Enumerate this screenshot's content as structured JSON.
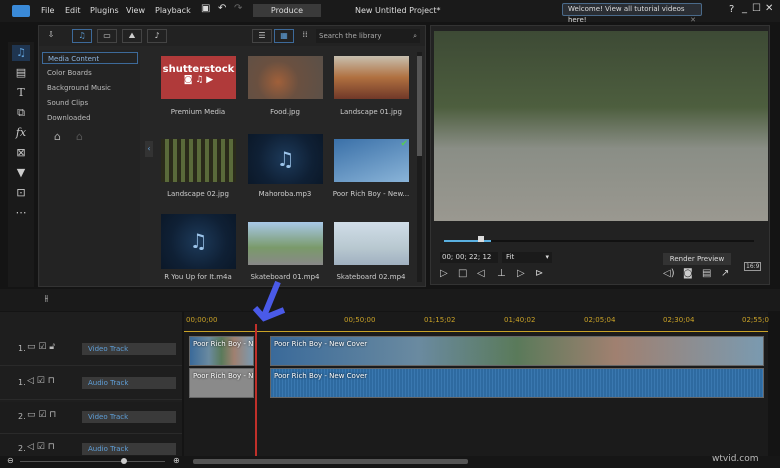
{
  "menu": {
    "items": [
      "File",
      "Edit",
      "Plugins",
      "View",
      "Playback"
    ],
    "produce": "Produce",
    "project_title": "New Untitled Project*",
    "welcome": "Welcome! View all tutorial videos here!",
    "help": "?"
  },
  "library": {
    "search_placeholder": "Search the library",
    "categories": [
      "Media Content",
      "Color Boards",
      "Background Music",
      "Sound Clips",
      "Downloaded"
    ],
    "items": [
      {
        "name": "Premium Media",
        "logo": "shutterstock"
      },
      {
        "name": "Food.jpg"
      },
      {
        "name": "Landscape 01.jpg"
      },
      {
        "name": "Landscape 02.jpg"
      },
      {
        "name": "Mahoroba.mp3"
      },
      {
        "name": "Poor Rich Boy - New..."
      },
      {
        "name": "R You Up for It.m4a"
      },
      {
        "name": "Skateboard 01.mp4"
      },
      {
        "name": "Skateboard 02.mp4"
      }
    ]
  },
  "preview": {
    "timecode": "00; 00; 22; 12",
    "zoom": "Fit",
    "render": "Render Preview",
    "aspect": "16:9",
    "progress": 0.15
  },
  "timeline": {
    "ruler": [
      "00;00;00",
      "00;50;00",
      "01;15;02",
      "01;40;02",
      "02;05;04",
      "02;30;04",
      "02;55;0"
    ],
    "tracks": [
      {
        "num": "1.",
        "label": "Video Track"
      },
      {
        "num": "1.",
        "label": "Audio Track"
      },
      {
        "num": "2.",
        "label": "Video Track"
      },
      {
        "num": "2.",
        "label": "Audio Track"
      }
    ],
    "clips": {
      "v1a": "Poor Rich Boy - New",
      "v1b": "Poor Rich Boy - New Cover",
      "a1a": "Poor Rich Boy - New",
      "a1b": "Poor Rich Boy - New Cover"
    }
  },
  "watermark": "wtvid.com"
}
